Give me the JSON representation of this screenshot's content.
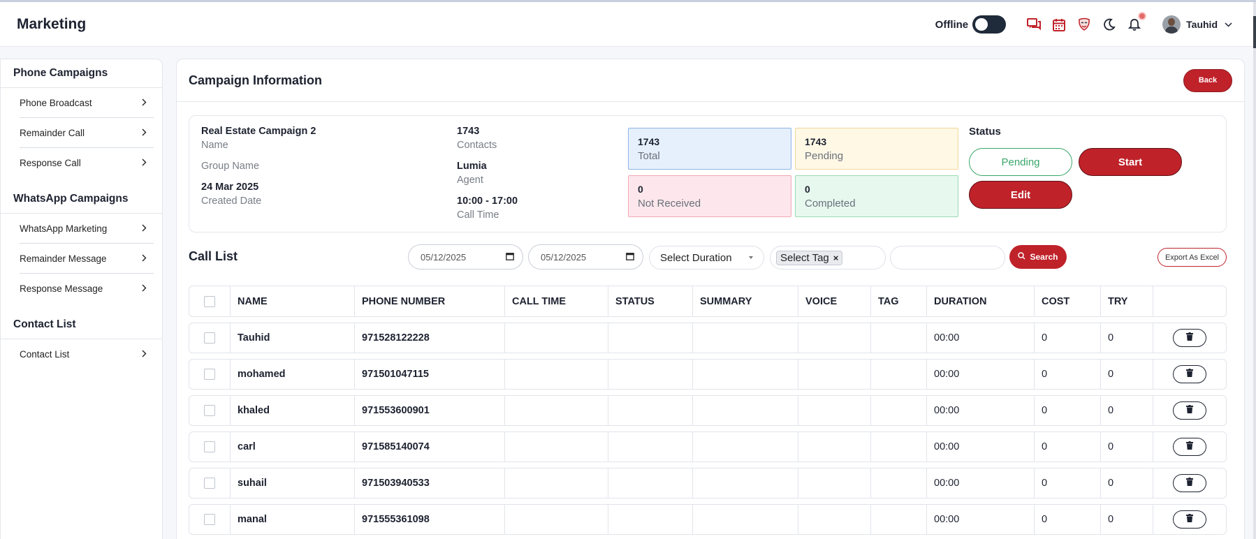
{
  "app": {
    "title": "Marketing"
  },
  "topbar": {
    "offline_label": "Offline",
    "icons": [
      "chat-icon",
      "calendar-icon",
      "mask-icon",
      "moon-icon",
      "bell-icon"
    ],
    "user_name": "Tauhid"
  },
  "colors": {
    "accent": "#c0222a",
    "dark": "#1d2230",
    "success": "#3aa66a"
  },
  "sidebar": {
    "sections": [
      {
        "title": "Phone Campaigns",
        "items": [
          "Phone Broadcast",
          "Remainder Call",
          "Response Call"
        ]
      },
      {
        "title": "WhatsApp Campaigns",
        "items": [
          "WhatsApp Marketing",
          "Remainder Message",
          "Response Message"
        ]
      },
      {
        "title": "Contact List",
        "items": [
          "Contact List"
        ]
      }
    ]
  },
  "main": {
    "title": "Campaign Information",
    "back_label": "Back",
    "campaign": {
      "name_value": "Real Estate Campaign 2",
      "name_label": "Name",
      "group_label": "Group Name",
      "created_value": "24 Mar 2025",
      "created_label": "Created Date",
      "contacts_value": "1743",
      "contacts_label": "Contacts",
      "agent_value": "Lumia",
      "agent_label": "Agent",
      "calltime_value": "10:00 - 17:00",
      "calltime_label": "Call Time"
    },
    "stats": {
      "total_value": "1743",
      "total_label": "Total",
      "pending_value": "1743",
      "pending_label": "Pending",
      "not_received_value": "0",
      "not_received_label": "Not Received",
      "completed_value": "0",
      "completed_label": "Completed"
    },
    "status": {
      "title": "Status",
      "pending_label": "Pending",
      "start_label": "Start",
      "edit_label": "Edit"
    },
    "call_list": {
      "title": "Call List",
      "date_from": "05/12/2025",
      "date_to": "05/12/2025",
      "duration_placeholder": "Select Duration",
      "tag_chip": "Select Tag",
      "search_label": "Search",
      "export_label": "Export As Excel"
    },
    "table": {
      "headers": [
        "NAME",
        "PHONE NUMBER",
        "CALL TIME",
        "STATUS",
        "SUMMARY",
        "VOICE",
        "TAG",
        "DURATION",
        "COST",
        "TRY"
      ],
      "rows": [
        {
          "name": "Tauhid",
          "phone": "971528122228",
          "call_time": "",
          "status": "",
          "summary": "",
          "voice": "",
          "tag": "",
          "duration": "00:00",
          "cost": "0",
          "try": "0"
        },
        {
          "name": "mohamed",
          "phone": "971501047115",
          "call_time": "",
          "status": "",
          "summary": "",
          "voice": "",
          "tag": "",
          "duration": "00:00",
          "cost": "0",
          "try": "0"
        },
        {
          "name": "khaled",
          "phone": "971553600901",
          "call_time": "",
          "status": "",
          "summary": "",
          "voice": "",
          "tag": "",
          "duration": "00:00",
          "cost": "0",
          "try": "0"
        },
        {
          "name": "carl",
          "phone": "971585140074",
          "call_time": "",
          "status": "",
          "summary": "",
          "voice": "",
          "tag": "",
          "duration": "00:00",
          "cost": "0",
          "try": "0"
        },
        {
          "name": "suhail",
          "phone": "971503940533",
          "call_time": "",
          "status": "",
          "summary": "",
          "voice": "",
          "tag": "",
          "duration": "00:00",
          "cost": "0",
          "try": "0"
        },
        {
          "name": "manal",
          "phone": "971555361098",
          "call_time": "",
          "status": "",
          "summary": "",
          "voice": "",
          "tag": "",
          "duration": "00:00",
          "cost": "0",
          "try": "0"
        }
      ]
    }
  }
}
